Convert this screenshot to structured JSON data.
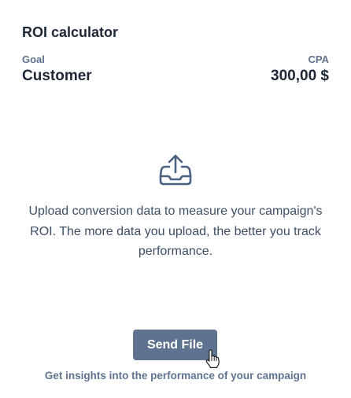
{
  "card": {
    "title": "ROI calculator",
    "goal": {
      "label": "Goal",
      "value": "Customer"
    },
    "cpa": {
      "label": "CPA",
      "value": "300,00 $"
    }
  },
  "upload": {
    "icon": "upload-tray-icon",
    "description": "Upload conversion data to measure your campaign's ROI. The more data you upload, the better you track performance.",
    "button_label": "Send File",
    "footnote": "Get insights into the performance of your campaign"
  },
  "cursor": {
    "icon": "hand-pointer-icon"
  },
  "colors": {
    "text_primary": "#1d2736",
    "text_muted": "#5f7390",
    "button_bg": "#5e7390",
    "button_text": "#ffffff",
    "icon_stroke": "#4a6182"
  }
}
